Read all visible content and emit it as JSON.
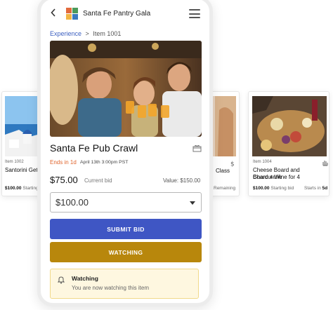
{
  "app": {
    "title": "Santa Fe Pantry Gala"
  },
  "breadcrumb": {
    "parent": "Experience",
    "separator": ">",
    "current": "Item 1001"
  },
  "item": {
    "title": "Santa Fe Pub Crawl",
    "ends_in": "Ends in 1d",
    "ends_date": "April 13th 3:00pm PST",
    "price": "$75.00",
    "price_label": "Current bid",
    "value": "Value: $150.00"
  },
  "bid": {
    "selected": "$100.00"
  },
  "buttons": {
    "submit": "SUBMIT BID",
    "watching": "WATCHING"
  },
  "notice": {
    "title": "Watching",
    "message": "You are now watching this item"
  },
  "cards": {
    "left": {
      "item_no": "Item 1002",
      "title": "Santorini Geta",
      "price": "$100.00",
      "price_label": "Starting"
    },
    "middle": {
      "title": "Class",
      "meta": "Remaining"
    },
    "right": {
      "item_no": "Item 1004",
      "title_line1": "Cheese Board and Charcuterie",
      "title_line2": "Board + Wine for 4",
      "price": "$100.00",
      "price_label": "Starting bid",
      "starts_label": "Starts in",
      "starts_value": "5d"
    }
  },
  "colors": {
    "accent_blue": "#3f56c4",
    "accent_gold": "#b8870c",
    "ends_orange": "#e0662e",
    "notice_bg": "#fef7e0"
  },
  "icons": [
    "back-chevron-icon",
    "logo-icon",
    "menu-icon",
    "gift-icon",
    "dropdown-caret-icon",
    "bell-icon",
    "dollar-icon",
    "hand-icon"
  ]
}
